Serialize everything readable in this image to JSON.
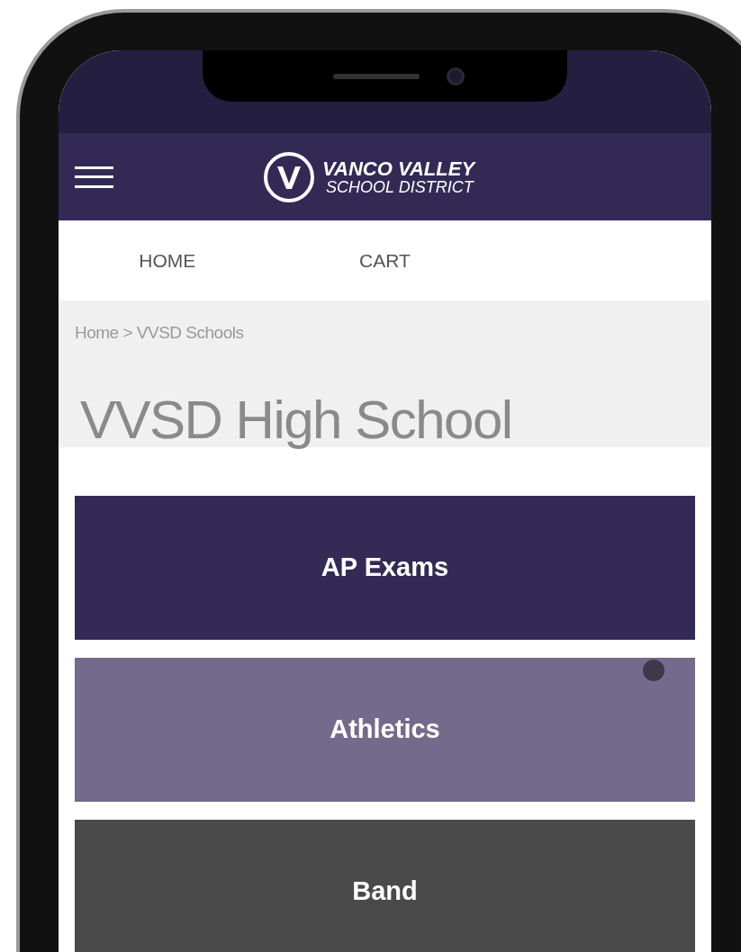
{
  "header": {
    "logo": {
      "line_1": "VANCO VALLEY",
      "line_2": "SCHOOL DISTRICT"
    }
  },
  "nav": [
    {
      "label": "HOME"
    },
    {
      "label": "CART"
    }
  ],
  "breadcrumb": "Home > VVSD Schools",
  "title": "VVSD High School",
  "tiles": [
    {
      "label": "AP Exams",
      "color": "#332b55",
      "touched": false
    },
    {
      "label": "Athletics",
      "color": "#746a8c",
      "touched": true
    },
    {
      "label": "Band",
      "color": "#4a4a4a",
      "touched": false
    }
  ]
}
